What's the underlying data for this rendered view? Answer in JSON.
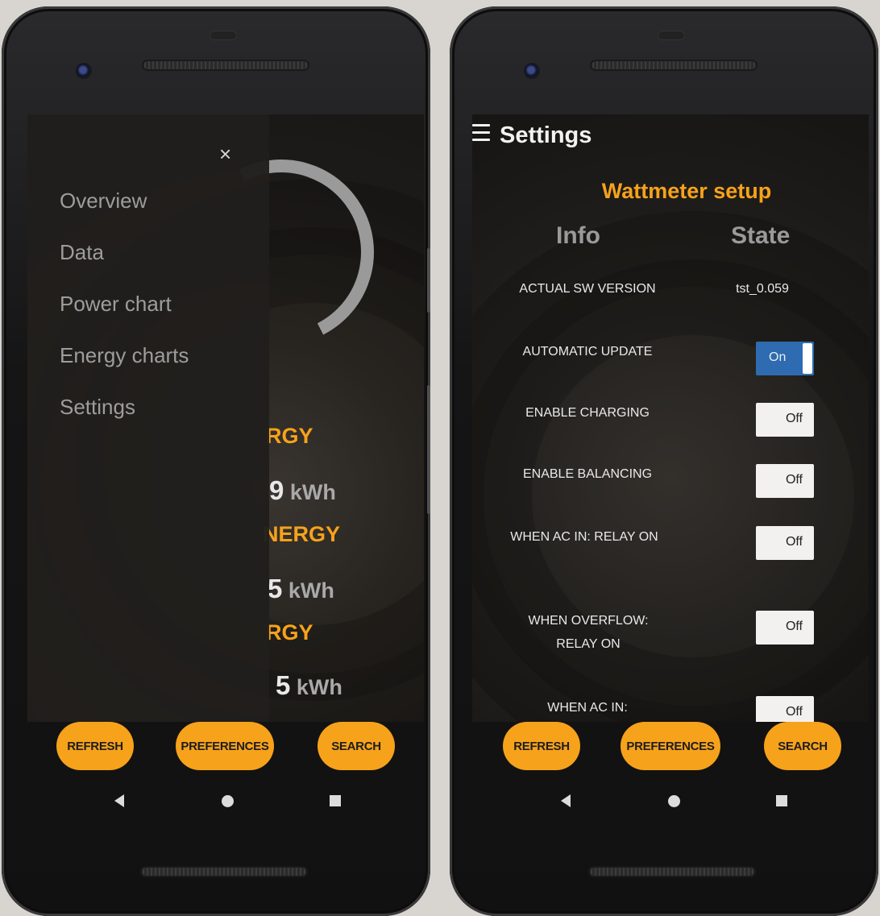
{
  "left_phone": {
    "drawer": {
      "close_icon": "×",
      "items": [
        "Overview",
        "Data",
        "Power chart",
        "Energy charts",
        "Settings"
      ]
    },
    "background_readouts": [
      {
        "label": "RGY",
        "value": "9",
        "unit": "kWh"
      },
      {
        "label": "NERGY",
        "value": "5",
        "unit": "kWh"
      },
      {
        "label": "RGY",
        "value": "5",
        "unit": "kWh"
      }
    ],
    "buttons": [
      "REFRESH",
      "PREFERENCES",
      "SEARCH"
    ]
  },
  "right_phone": {
    "page_title": "Settings",
    "section_title": "Wattmeter setup",
    "columns": {
      "info": "Info",
      "state": "State"
    },
    "rows": [
      {
        "label": "ACTUAL SW VERSION",
        "value": "tst_0.059"
      },
      {
        "label": "AUTOMATIC UPDATE",
        "toggle": "On"
      },
      {
        "label": "ENABLE CHARGING",
        "toggle": "Off"
      },
      {
        "label": "ENABLE BALANCING",
        "toggle": "Off"
      },
      {
        "label": "WHEN AC IN: RELAY ON",
        "toggle": "Off"
      },
      {
        "label": "WHEN OVERFLOW: RELAY ON",
        "toggle": "Off"
      },
      {
        "label": "WHEN AC IN:",
        "toggle": "Off"
      }
    ],
    "buttons": [
      "REFRESH",
      "PREFERENCES",
      "SEARCH"
    ]
  },
  "colors": {
    "accent": "#f7a21b",
    "toggle_on": "#2f6bb0",
    "screen_bg": "#1d1b19"
  },
  "icons": {
    "menu": "hamburger-icon",
    "close": "close-icon",
    "back": "back-triangle-icon",
    "home": "home-circle-icon",
    "recents": "recents-square-icon"
  }
}
